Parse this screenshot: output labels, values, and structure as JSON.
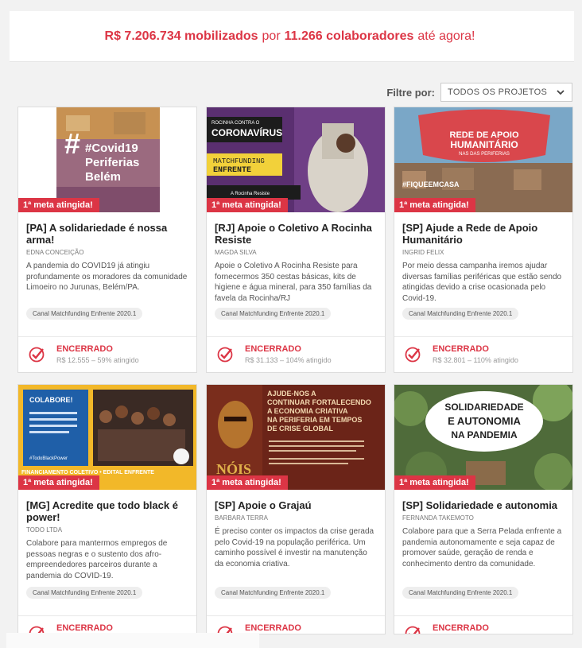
{
  "banner": {
    "amount": "R$ 7.206.734 mobilizados",
    "by": "por",
    "count": "11.266 colaboradores",
    "suffix": "até agora!"
  },
  "filter": {
    "label": "Filtre por:",
    "selected": "TODOS OS PROJETOS"
  },
  "colors": {
    "accent": "#dc3545"
  },
  "cards": [
    {
      "badge": "1ª meta atingida!",
      "title": "[PA] A solidariedade é nossa arma!",
      "owner": "EDNA CONCEIÇÃO",
      "desc": "A pandemia do COVID19 já atingiu profundamente os moradores da comunidade Limoeiro no Jurunas, Belém/PA.",
      "channel": "Canal Matchfunding Enfrente 2020.1",
      "status": "ENCERRADO",
      "progress": "R$ 12.555 – 59% atingido",
      "image_text": [
        "#Covid19",
        "Periferias",
        "Belém"
      ]
    },
    {
      "badge": "1ª meta atingida!",
      "title": "[RJ] Apoie o Coletivo A Rocinha Resiste",
      "owner": "MAGDA SILVA",
      "desc": "Apoie o Coletivo A Rocinha Resiste para fornecermos 350 cestas básicas, kits de higiene e água mineral, para 350 famílias da favela da Rocinha/RJ",
      "channel": "Canal Matchfunding Enfrente 2020.1",
      "status": "ENCERRADO",
      "progress": "R$ 31.133 – 104% atingido",
      "image_text": [
        "ROCINHA CONTRA O",
        "CORONAVÍRUS",
        "MATCHFUNDING",
        "ENFRENTE",
        "A Rocinha Resiste"
      ]
    },
    {
      "badge": "1ª meta atingida!",
      "title": "[SP] Ajude a Rede de Apoio Humanitário",
      "owner": "INGRID FELIX",
      "desc": "Por meio dessa campanha iremos ajudar diversas famílias periféricas que estão sendo atingidas devido a crise ocasionada pelo Covid-19.",
      "channel": "Canal Matchfunding Enfrente 2020.1",
      "status": "ENCERRADO",
      "progress": "R$ 32.801 – 110% atingido",
      "image_text": [
        "REDE DE APOIO",
        "HUMANITÁRIO",
        "NAS DAS PERIFERIAS",
        "#FIQUEEMCASA"
      ]
    },
    {
      "badge": "1ª meta atingida!",
      "title": "[MG] Acredite que todo black é power!",
      "owner": "TODO LTDA",
      "desc": "Colabore para mantermos empregos de pessoas negras e o sustento dos afro-empreendedores parceiros durante a pandemia do COVID-19.",
      "channel": "Canal Matchfunding Enfrente 2020.1",
      "status": "ENCERRADO",
      "progress": "",
      "image_text": [
        "COLABORE!",
        "#TodoBlackPower",
        "FINANCIAMENTO COLETIVO • EDITAL ENFRENTE"
      ]
    },
    {
      "badge": "1ª meta atingida!",
      "title": "[SP] Apoie o Grajaú",
      "owner": "BARBARA TERRA",
      "desc": "É preciso conter os impactos da crise gerada pelo Covid-19 na população periférica. Um caminho possível é investir na manutenção da economia criativa.",
      "channel": "Canal Matchfunding Enfrente 2020.1",
      "status": "ENCERRADO",
      "progress": "",
      "image_text": [
        "AJUDE-NOS A",
        "CONTINUAR FORTALECENDO",
        "A ECONOMIA CRIATIVA",
        "NA PERIFERIA EM TEMPOS",
        "DE CRISE GLOBAL",
        "NÓIS"
      ]
    },
    {
      "badge": "1ª meta atingida!",
      "title": "[SP] Solidariedade e autonomia",
      "owner": "FERNANDA TAKEMOTO",
      "desc": "Colabore para que a Serra Pelada enfrente a pandemia autonomamente e seja capaz de promover saúde, geração de renda e conhecimento dentro da comunidade.",
      "channel": "Canal Matchfunding Enfrente 2020.1",
      "status": "ENCERRADO",
      "progress": "",
      "image_text": [
        "SOLIDARIEDADE",
        "E AUTONOMIA",
        "NA PANDEMIA"
      ]
    }
  ]
}
